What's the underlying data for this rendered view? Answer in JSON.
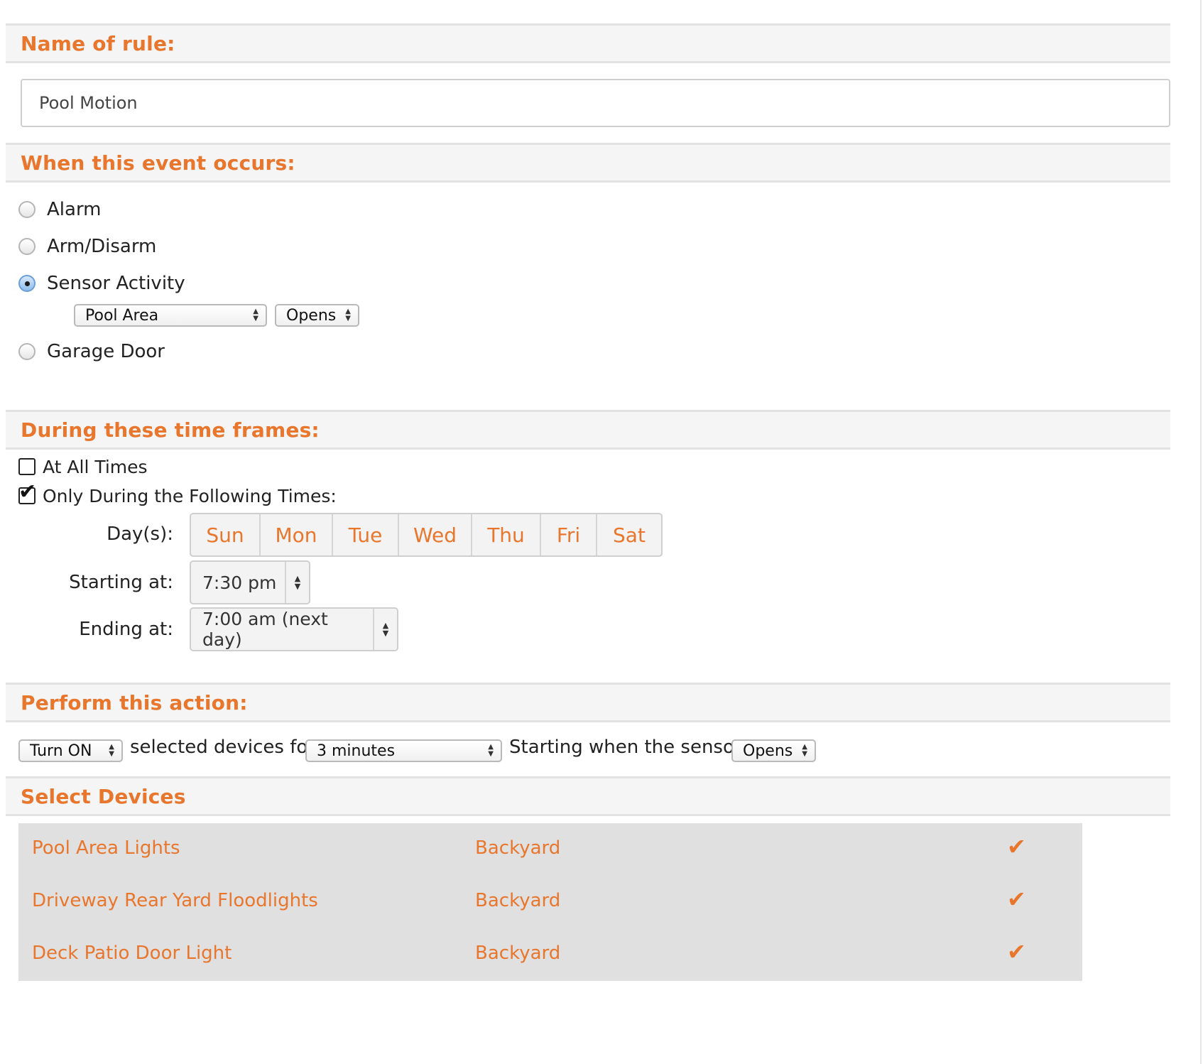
{
  "sections": {
    "name": "Name of rule:",
    "event": "When this event occurs:",
    "time": "During these time frames:",
    "action": "Perform this action:",
    "devices": "Select Devices"
  },
  "rule_name": {
    "value": "Pool Motion"
  },
  "event": {
    "options": [
      "Alarm",
      "Arm/Disarm",
      "Sensor Activity",
      "Garage Door"
    ],
    "selected": "Sensor Activity",
    "sensor_select": "Pool Area",
    "sensor_state_select": "Opens"
  },
  "time": {
    "all_times_label": "At All Times",
    "all_times_checked": false,
    "following_times_label": "Only During the Following Times:",
    "following_times_checked": true,
    "days_label": "Day(s):",
    "days": [
      "Sun",
      "Mon",
      "Tue",
      "Wed",
      "Thu",
      "Fri",
      "Sat"
    ],
    "start_label": "Starting at:",
    "start_value": "7:30 pm",
    "end_label": "Ending at:",
    "end_value": "7:00 am (next day)"
  },
  "action": {
    "action_select": "Turn ON",
    "text1": "selected devices for",
    "duration_select": "3 minutes",
    "text2": "Starting when the sensor",
    "trigger_select": "Opens"
  },
  "devices": [
    {
      "name": "Pool Area Lights",
      "zone": "Backyard",
      "selected": true
    },
    {
      "name": "Driveway Rear Yard Floodlights",
      "zone": "Backyard",
      "selected": true
    },
    {
      "name": "Deck Patio Door Light",
      "zone": "Backyard",
      "selected": true
    }
  ],
  "colors": {
    "accent": "#e8762c",
    "header_bg": "#f5f5f5",
    "table_bg": "#e0e0e0"
  },
  "icons": {
    "select_arrows": "updown-arrows-icon",
    "device_selected": "checkmark-icon"
  }
}
